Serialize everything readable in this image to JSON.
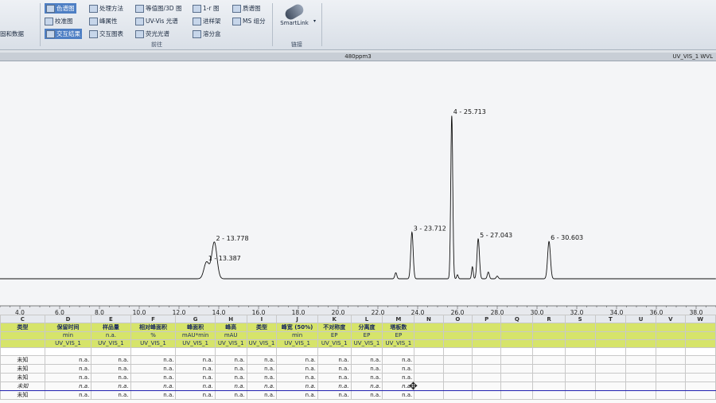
{
  "ribbon": {
    "left_partial": "固和数据",
    "buttons": [
      {
        "label": "色谱图",
        "icon": "chromatogram-icon",
        "selected": true
      },
      {
        "label": "处理方法",
        "icon": "method-icon",
        "selected": false
      },
      {
        "label": "等值图/3D 图",
        "icon": "contour-icon",
        "selected": false
      },
      {
        "label": "1-r 图",
        "icon": "plot-icon",
        "selected": false
      },
      {
        "label": "质谱图",
        "icon": "ms-icon",
        "selected": false
      },
      {
        "label": "校准图",
        "icon": "calibration-icon",
        "selected": false
      },
      {
        "label": "峰属性",
        "icon": "peak-icon",
        "selected": false
      },
      {
        "label": "UV-Vis 光谱",
        "icon": "spectrum-icon",
        "selected": false
      },
      {
        "label": "进样架",
        "icon": "rack-icon",
        "selected": false
      },
      {
        "label": "MS 组分",
        "icon": "ms-component-icon",
        "selected": false
      },
      {
        "label": "交互结果",
        "icon": "interactive-icon",
        "selected": true
      },
      {
        "label": "交互图表",
        "icon": "chart-icon",
        "selected": false
      },
      {
        "label": "荧光光谱",
        "icon": "fluorescence-icon",
        "selected": false
      },
      {
        "label": "溶分盒",
        "icon": "box-icon",
        "selected": false
      }
    ],
    "group_views": "前往",
    "group_link": "链接",
    "smartlink": "SmartLink"
  },
  "window": {
    "title": "480ppm3",
    "right_label": "UV_VIS_1 WVL"
  },
  "chart_data": {
    "type": "line",
    "xlim": [
      3.0,
      39.0
    ],
    "x_ticks": [
      4.0,
      6.0,
      8.0,
      10.0,
      12.0,
      14.0,
      16.0,
      18.0,
      20.0,
      22.0,
      24.0,
      26.0,
      28.0,
      30.0,
      32.0,
      34.0,
      36.0,
      38.0
    ],
    "x_tick_labels": [
      "4.0",
      "6.0",
      "8.0",
      "10.0",
      "12.0",
      "14.0",
      "16.0",
      "18.0",
      "20.0",
      "22.0",
      "24.0",
      "26.0",
      "28.0",
      "30.0",
      "32.0",
      "34.0",
      "36.0",
      "38.0"
    ],
    "baseline": 0,
    "ylim": [
      -5,
      300
    ],
    "peaks": [
      {
        "label": "1 - 13.387",
        "rt": 13.387,
        "height": 25,
        "width": 0.13
      },
      {
        "label": "2 - 13.778",
        "rt": 13.778,
        "height": 55,
        "width": 0.13
      },
      {
        "label": "3 - 23.712",
        "rt": 23.712,
        "height": 70,
        "width": 0.06
      },
      {
        "label": "4 - 25.713",
        "rt": 25.713,
        "height": 245,
        "width": 0.05
      },
      {
        "label": "5 - 27.043",
        "rt": 27.043,
        "height": 60,
        "width": 0.06
      },
      {
        "label": "6 - 30.603",
        "rt": 30.603,
        "height": 56,
        "width": 0.07
      }
    ],
    "minor_peaks": [
      {
        "rt": 22.9,
        "height": 9,
        "width": 0.05
      },
      {
        "rt": 26.0,
        "height": 6,
        "width": 0.04
      },
      {
        "rt": 26.75,
        "height": 18,
        "width": 0.04
      },
      {
        "rt": 27.55,
        "height": 10,
        "width": 0.05
      },
      {
        "rt": 28.0,
        "height": 4,
        "width": 0.05
      }
    ]
  },
  "table": {
    "column_letters": [
      "C",
      "D",
      "E",
      "F",
      "G",
      "H",
      "I",
      "J",
      "K",
      "L",
      "M",
      "N",
      "O",
      "P",
      "Q",
      "R",
      "S",
      "T",
      "U",
      "V",
      "W"
    ],
    "header_row1": [
      "类型",
      "保留时间",
      "样品量",
      "相对峰面积",
      "峰面积",
      "峰高",
      "类型",
      "峰宽 (50%)",
      "不对称度",
      "分离度",
      "塔板数"
    ],
    "header_row2": [
      "",
      "min",
      "n.a.",
      "%",
      "mAU*min",
      "mAU",
      "",
      "min",
      "EP",
      "EP",
      "EP"
    ],
    "header_row3": [
      "",
      "UV_VIS_1",
      "UV_VIS_1",
      "UV_VIS_1",
      "UV_VIS_1",
      "UV_VIS_1",
      "UV_VIS_1",
      "UV_VIS_1",
      "UV_VIS_1",
      "UV_VIS_1",
      "UV_VIS_1"
    ],
    "rows": [
      [
        "未知",
        "n.a.",
        "n.a.",
        "n.a.",
        "n.a.",
        "n.a.",
        "n.a.",
        "n.a.",
        "n.a.",
        "n.a.",
        "n.a."
      ],
      [
        "未知",
        "n.a.",
        "n.a.",
        "n.a.",
        "n.a.",
        "n.a.",
        "n.a.",
        "n.a.",
        "n.a.",
        "n.a.",
        "n.a."
      ],
      [
        "未知",
        "n.a.",
        "n.a.",
        "n.a.",
        "n.a.",
        "n.a.",
        "n.a.",
        "n.a.",
        "n.a.",
        "n.a.",
        "n.a."
      ],
      [
        "未知",
        "n.a.",
        "n.a.",
        "n.a.",
        "n.a.",
        "n.a.",
        "n.a.",
        "n.a.",
        "n.a.",
        "n.a.",
        "n.a."
      ],
      [
        "未知",
        "n.a.",
        "n.a.",
        "n.a.",
        "n.a.",
        "n.a.",
        "n.a.",
        "n.a.",
        "n.a.",
        "n.a.",
        "n.a."
      ]
    ],
    "selected_row": 3
  }
}
